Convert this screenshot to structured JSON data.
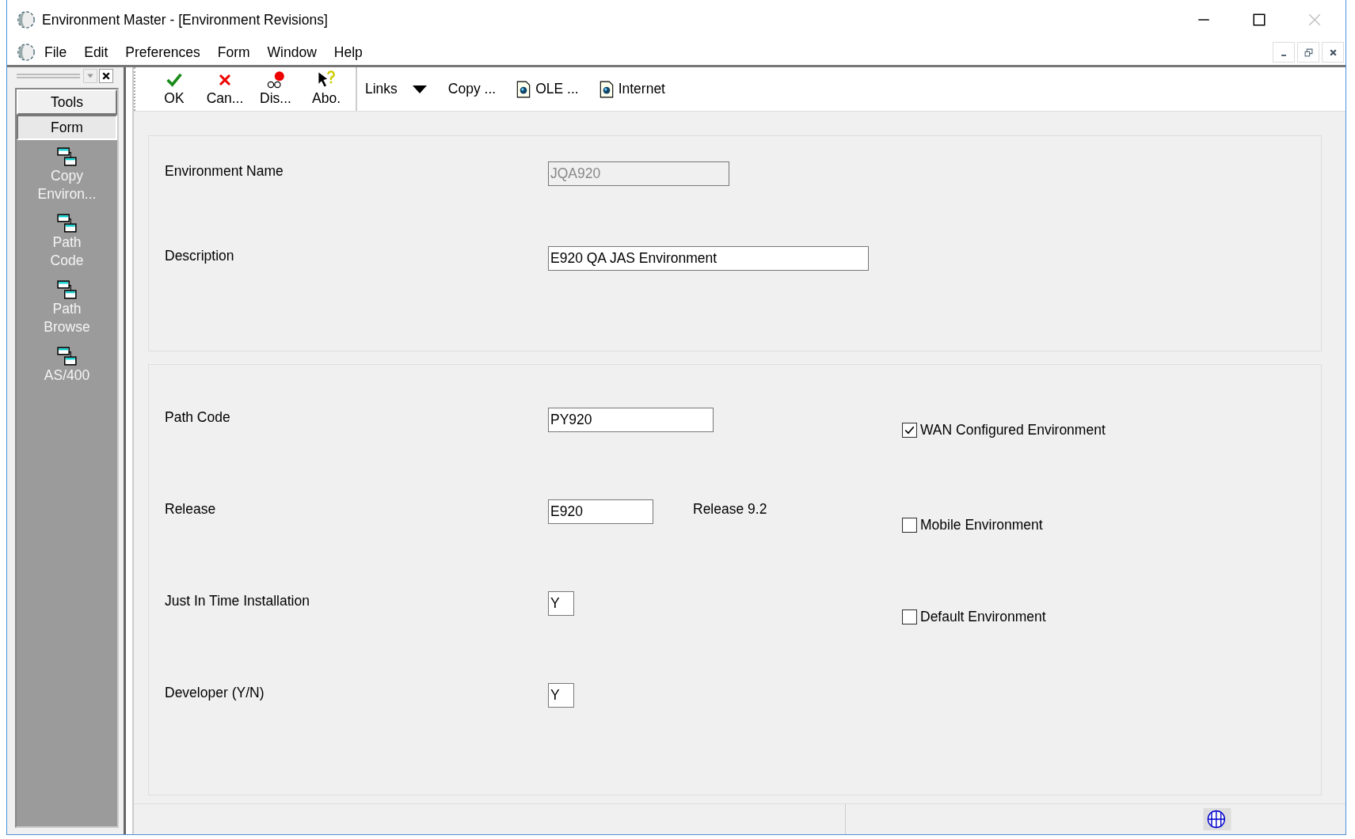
{
  "window": {
    "title": "Environment Master - [Environment Revisions]"
  },
  "menu": [
    "File",
    "Edit",
    "Preferences",
    "Form",
    "Window",
    "Help"
  ],
  "sidebar": {
    "tabs": [
      {
        "label": "Tools",
        "selected": false
      },
      {
        "label": "Form",
        "selected": true
      }
    ],
    "items": [
      "Copy Environ...",
      "Path Code",
      "Path Browse",
      "AS/400"
    ]
  },
  "toolbar": {
    "buttons": [
      {
        "label": "OK",
        "kind": "ok"
      },
      {
        "label": "Can...",
        "kind": "cancel"
      },
      {
        "label": "Dis...",
        "kind": "display"
      },
      {
        "label": "Abo.",
        "kind": "about"
      }
    ],
    "links": [
      {
        "label": "Links",
        "kind": "dropdown"
      },
      {
        "label": "Copy ...",
        "kind": "text"
      },
      {
        "label": "OLE ...",
        "kind": "doc"
      },
      {
        "label": "Internet",
        "kind": "doc"
      }
    ]
  },
  "header": [
    {
      "label": "Environment Name",
      "value": "JQA920",
      "disabled": true
    },
    {
      "label": "Description",
      "value": "E920 QA JAS Environment",
      "disabled": false
    }
  ],
  "detail": [
    {
      "label": "Path Code",
      "value": "PY920",
      "checkbox": {
        "label": "WAN Configured Environment",
        "checked": true
      }
    },
    {
      "label": "Release",
      "value": "E920",
      "note": "Release 9.2",
      "checkbox": {
        "label": "Mobile Environment",
        "checked": false
      }
    },
    {
      "label": "Just In Time Installation",
      "value": "Y",
      "checkbox": {
        "label": "Default Environment",
        "checked": false
      }
    },
    {
      "label": "Developer (Y/N)",
      "value": "Y"
    }
  ]
}
